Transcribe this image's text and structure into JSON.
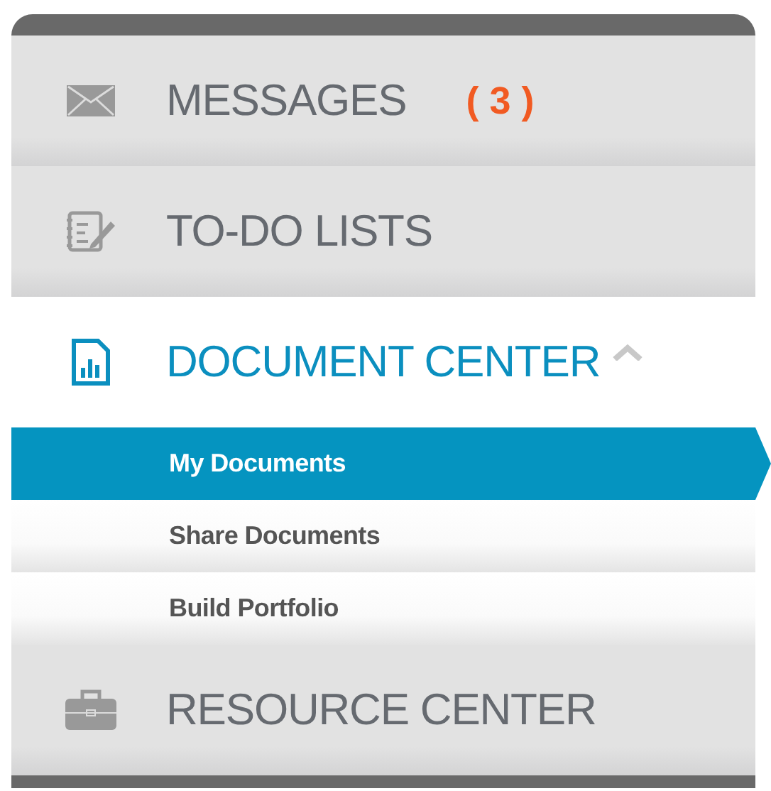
{
  "menu": [
    {
      "label": "MESSAGES",
      "badge": "( 3 )",
      "expanded": false
    },
    {
      "label": "TO-DO LISTS",
      "expanded": false
    },
    {
      "label": "DOCUMENT CENTER",
      "expanded": true,
      "children": [
        {
          "label": "My Documents",
          "selected": true
        },
        {
          "label": "Share Documents",
          "selected": false
        },
        {
          "label": "Build Portfolio",
          "selected": false
        }
      ]
    },
    {
      "label": "RESOURCE CENTER",
      "expanded": false
    }
  ]
}
